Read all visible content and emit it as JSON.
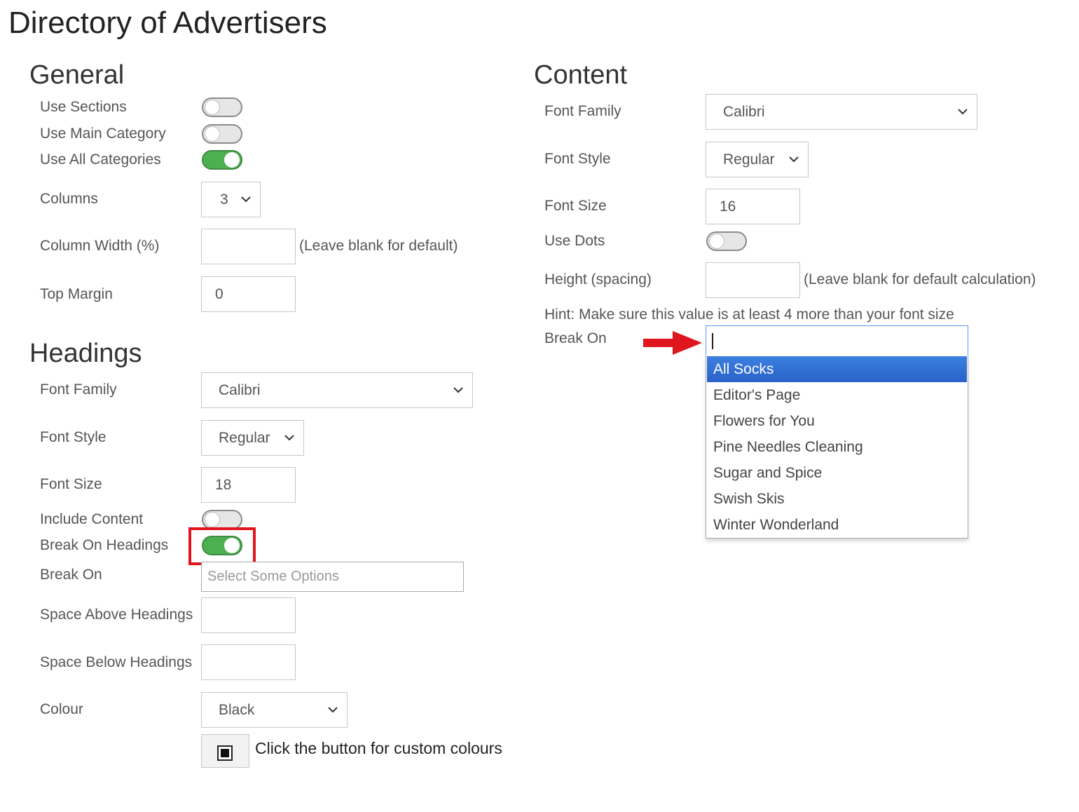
{
  "page_title": "Directory of Advertisers",
  "general": {
    "title": "General",
    "use_sections": {
      "label": "Use Sections",
      "on": false
    },
    "use_main_category": {
      "label": "Use Main Category",
      "on": false
    },
    "use_all_categories": {
      "label": "Use All Categories",
      "on": true
    },
    "columns": {
      "label": "Columns",
      "value": "3"
    },
    "column_width": {
      "label": "Column Width (%)",
      "value": "",
      "note": "(Leave blank for default)"
    },
    "top_margin": {
      "label": "Top Margin",
      "value": "0"
    }
  },
  "headings": {
    "title": "Headings",
    "font_family": {
      "label": "Font Family",
      "value": "Calibri"
    },
    "font_style": {
      "label": "Font Style",
      "value": "Regular"
    },
    "font_size": {
      "label": "Font Size",
      "value": "18"
    },
    "include_content": {
      "label": "Include Content",
      "on": false
    },
    "break_on_headings": {
      "label": "Break On Headings",
      "on": true
    },
    "break_on": {
      "label": "Break On",
      "placeholder": "Select Some Options"
    },
    "space_above": {
      "label": "Space Above Headings",
      "value": ""
    },
    "space_below": {
      "label": "Space Below Headings",
      "value": ""
    },
    "colour": {
      "label": "Colour",
      "value": "Black"
    },
    "custom_colour_note": "Click the button for custom colours"
  },
  "content": {
    "title": "Content",
    "font_family": {
      "label": "Font Family",
      "value": "Calibri"
    },
    "font_style": {
      "label": "Font Style",
      "value": "Regular"
    },
    "font_size": {
      "label": "Font Size",
      "value": "16"
    },
    "use_dots": {
      "label": "Use Dots",
      "on": false
    },
    "height_spacing": {
      "label": "Height (spacing)",
      "value": "",
      "note": "(Leave blank for default calculation)"
    },
    "hint": "Hint: Make sure this value is at least 4 more than your font size",
    "break_on": {
      "label": "Break On",
      "search_value": "",
      "options": [
        "All Socks",
        "Editor's Page",
        "Flowers for You",
        "Pine Needles Cleaning",
        "Sugar and Spice",
        "Swish Skis",
        "Winter Wonderland"
      ],
      "highlighted": "All Socks"
    }
  },
  "colors": {
    "toggle_on": "#4caf50",
    "highlight_option": "#3875d7",
    "annotation_red": "#e0161f"
  }
}
